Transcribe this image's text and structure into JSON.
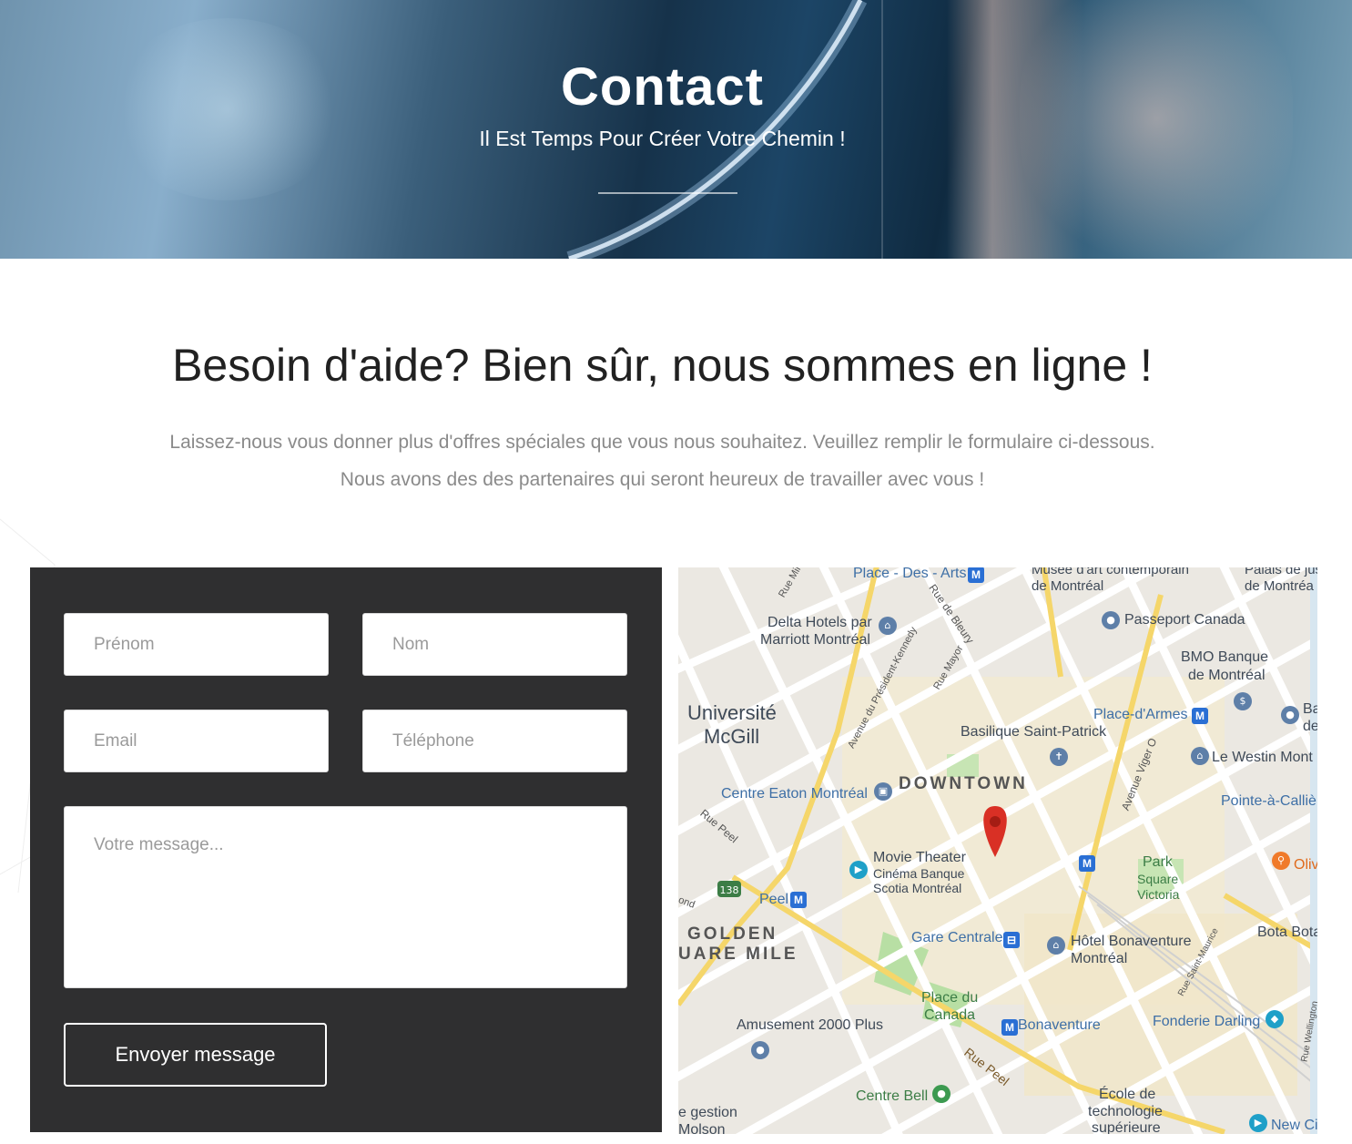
{
  "hero": {
    "title": "Contact",
    "subtitle": "Il Est Temps Pour Créer Votre Chemin !"
  },
  "section": {
    "title": "Besoin d'aide? Bien sûr, nous sommes en ligne !",
    "text_line1": "Laissez-nous vous donner plus d'offres spéciales que vous nous souhaitez. Veuillez remplir le formulaire ci-dessous.",
    "text_line2": "Nous avons des des partenaires qui seront heureux de travailler avec vous !"
  },
  "form": {
    "first_name_placeholder": "Prénom",
    "last_name_placeholder": "Nom",
    "email_placeholder": "Email",
    "phone_placeholder": "Téléphone",
    "message_placeholder": "Votre message...",
    "submit_label": "Envoyer message"
  },
  "map": {
    "labels": {
      "place_des_arts": "Place - Des - Arts",
      "musee_1": "Musée d'art contemporain",
      "musee_2": "de Montréal",
      "palais_1": "Palais de justice",
      "palais_2": "de Montréa",
      "delta_1": "Delta Hotels par",
      "delta_2": "Marriott Montréal",
      "passeport": "Passeport Canada",
      "bmo_1": "BMO Banque",
      "bmo_2": "de Montréal",
      "universite_1": "Université",
      "universite_2": "McGill",
      "place_d_armes": "Place-d'Armes",
      "ba": "Ba",
      "de": "de",
      "basilique": "Basilique Saint-Patrick",
      "westin": "Le Westin Mont",
      "downtown": "DOWNTOWN",
      "eaton": "Centre Eaton Montréal",
      "pointe": "Pointe-à-Callière",
      "movie_1": "Movie Theater",
      "movie_2": "Cinéma Banque",
      "movie_3": "Scotia Montréal",
      "park_1": "Park",
      "park_2": "Square",
      "park_3": "Victoria",
      "oliv": "Oliv",
      "peel": "Peel",
      "golden_1": "GOLDEN",
      "golden_2": "UARE MILE",
      "gare": "Gare Centrale",
      "bonaventure_hotel_1": "Hôtel Bonaventure",
      "bonaventure_hotel_2": "Montréal",
      "bota": "Bota Bota",
      "place_canada_1": "Place du",
      "place_canada_2": "Canada",
      "amusement": "Amusement 2000 Plus",
      "bonaventure": "Bonaventure",
      "fonderie": "Fonderie Darling",
      "centre_bell": "Centre Bell",
      "ecole_1": "École de",
      "ecole_2": "technologie",
      "ecole_3": "supérieure",
      "gestion_1": "e gestion",
      "gestion_2": "Molson",
      "new_ci": "New Ci",
      "rue_peel_top": "Rue Peel",
      "rue_peel_bottom": "Rue Peel",
      "rue_bleury": "Rue de Bleury",
      "rue_mayor": "Rue Mayor",
      "rue_milton": "Rue Mil",
      "av_president": "Avenue du Président-Kennedy",
      "av_viger": "Avenue Viger O",
      "rue_st_maurice": "Rue Saint-Maurice",
      "rue_wellington": "Rue Wellington",
      "route_138": "138",
      "ond": "ond"
    }
  },
  "colors": {
    "panel_bg": "#2f2f30",
    "title_text": "#212121",
    "body_text": "#8a8a8a",
    "map_pin": "#d93025",
    "metro": "#2a6fd4"
  }
}
